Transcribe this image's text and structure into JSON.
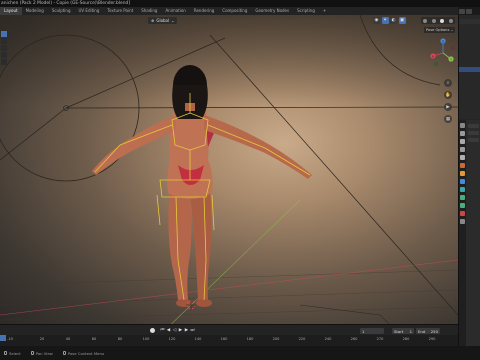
{
  "window": {
    "title": "anichen (Pack 2 Model) - Copie (GE-Source)\\Blender.blend]"
  },
  "workspace_tabs": [
    "Layout",
    "Modeling",
    "Sculpting",
    "UV Editing",
    "Texture Paint",
    "Shading",
    "Animation",
    "Rendering",
    "Compositing",
    "Geometry Nodes",
    "Scripting",
    "+"
  ],
  "active_tab": "Layout",
  "viewport": {
    "mode": "Global",
    "pose_options": "Pose Options",
    "axes": {
      "x": "X",
      "y": "Y",
      "z": "Z"
    },
    "colors": {
      "axis_x": "#d8485a",
      "axis_y": "#8bc34a",
      "axis_z": "#4a88d8",
      "bone": "#e8c83a",
      "selection": "#4772b3"
    }
  },
  "timeline": {
    "current_frame": "1",
    "start_label": "Start",
    "start_value": "1",
    "end_label": "End",
    "end_value": "250",
    "ruler_ticks": [
      "-10",
      "20",
      "40",
      "60",
      "80",
      "100",
      "120",
      "140",
      "160",
      "180",
      "200",
      "220",
      "240",
      "260",
      "270",
      "280",
      "290"
    ]
  },
  "status": {
    "select": "Select",
    "pan": "Pan View",
    "context": "Pose Context Menu"
  },
  "icons": {
    "gizmo": "navigation-gizmo",
    "zoom": "zoom-icon",
    "pan": "hand-icon",
    "camera": "camera-icon",
    "grid": "grid-icon"
  }
}
